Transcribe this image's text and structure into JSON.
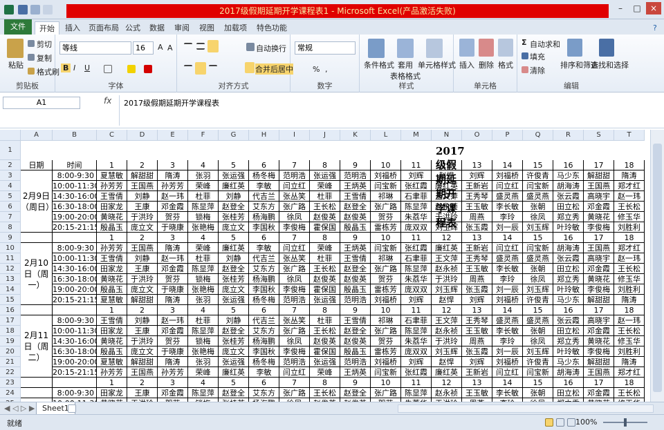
{
  "window": {
    "title": "2017级假期延期开学课程表1 - Microsoft Excel(产品激活失败)"
  },
  "ribbon": {
    "tabs": [
      "文件",
      "开始",
      "插入",
      "页面布局",
      "公式",
      "数据",
      "审阅",
      "视图",
      "加载项",
      "特色功能"
    ],
    "clipboard": {
      "paste": "粘贴",
      "cut": "剪切",
      "copy": "复制",
      "format_painter": "格式刷",
      "label": "剪贴板"
    },
    "font": {
      "name": "等线",
      "size": "16",
      "label": "字体"
    },
    "alignment": {
      "wrap": "自动换行",
      "merge": "合并后居中",
      "label": "对齐方式"
    },
    "number": {
      "format": "常规",
      "label": "数字"
    },
    "styles": {
      "cond": "条件格式",
      "table": "套用\n表格格式",
      "cell": "单元格样式",
      "label": "样式"
    },
    "cells": {
      "insert": "插入",
      "delete": "删除",
      "format": "格式",
      "label": "单元格"
    },
    "editing": {
      "autosum": "自动求和",
      "fill": "填充",
      "clear": "清除",
      "sort": "排序和筛选",
      "find": "查找和选择",
      "label": "编辑"
    }
  },
  "formula_bar": {
    "name_box": "A1",
    "fx": "fx",
    "content": "2017级假期延期开学课程表"
  },
  "columns": [
    "A",
    "B",
    "C",
    "D",
    "E",
    "F",
    "G",
    "H",
    "I",
    "J",
    "K",
    "L",
    "M",
    "N",
    "O",
    "P",
    "Q",
    "R",
    "S",
    "T"
  ],
  "rows": [
    "1",
    "2",
    "3",
    "4",
    "5",
    "6",
    "7",
    "8",
    "9",
    "10",
    "11",
    "12",
    "13",
    "14",
    "15",
    "16",
    "17",
    "18",
    "19",
    "20",
    "21",
    "22",
    "23",
    "24",
    "25"
  ],
  "sheet": {
    "title": "2017级假期延期开学课程表",
    "header": {
      "date": "日期",
      "time": "时间"
    },
    "nums": [
      "1",
      "2",
      "3",
      "4",
      "5",
      "6",
      "7",
      "8",
      "9",
      "10",
      "11",
      "12",
      "13",
      "14",
      "15",
      "16",
      "17",
      "18"
    ],
    "days": [
      "2月9日（周日）",
      "2月10日（周一）",
      "2月11日（周二）"
    ],
    "times_a": [
      "8:00-9:30",
      "10:00-11:30",
      "14:30-16:00",
      "16:30-18:00",
      "19:00-20:00",
      "20:15-21:15"
    ],
    "times_b": [
      "8:00-9:30",
      "10:00-11:30",
      "14:30-16:00",
      "16:30-18:00",
      "19:00-20:00",
      "20:15-21:15"
    ],
    "r3": [
      "夏慧敏",
      "解甜甜",
      "隋涛",
      "张羽",
      "张运强",
      "杨冬梅",
      "范明浩",
      "张运强",
      "范明浩",
      "刘福桥",
      "刘辉",
      "赵悍",
      "刘辉",
      "刘福桥",
      "许俊青",
      "马少东",
      "解甜甜",
      "隋涛"
    ],
    "r4": [
      "孙芳芳",
      "王国燕",
      "孙芳芳",
      "荣峰",
      "廉红英",
      "李敏",
      "闫立红",
      "荣峰",
      "王炳英",
      "闫宝新",
      "张红霞",
      "廉红英",
      "王新岩",
      "闫立红",
      "闫宝新",
      "胡海涛",
      "王国燕",
      "郑才红"
    ],
    "r5": [
      "王雪倩",
      "刘静",
      "赵一玮",
      "杜菲",
      "刘静",
      "代吉兰",
      "张丛笑",
      "杜菲",
      "王雪倩",
      "祁琳",
      "石聿菲",
      "王文萍",
      "王秀琴",
      "盛灵燕",
      "盛灵燕",
      "张云霞",
      "高晓宇",
      "赵一玮"
    ],
    "r6": [
      "田家龙",
      "王康",
      "邓金霞",
      "陈显萍",
      "赵登全",
      "艾东方",
      "张广路",
      "王长松",
      "赵登全",
      "张广路",
      "陈显萍",
      "赵永祯",
      "王玉敏",
      "李长敏",
      "张朝",
      "田立松",
      "邓金霞",
      "王长松"
    ],
    "r7": [
      "黄晓花",
      "于洪玲",
      "贺芬",
      "锁梅",
      "张桂芳",
      "杨海鹏",
      "徐凤",
      "赵俊英",
      "赵俊英",
      "贺芬",
      "朱荔华",
      "于洪玲",
      "周燕",
      "李玲",
      "徐凤",
      "郑立秀",
      "黄晓花",
      "修玉华"
    ],
    "r8": [
      "殷晶玉",
      "庞立文",
      "于晓康",
      "张艳梅",
      "庞立文",
      "李国秋",
      "李俊梅",
      "霍保国",
      "殷晶玉",
      "雷栋芳",
      "庞双双",
      "刘玉辉",
      "张玉霞",
      "刘一辰",
      "刘玉辉",
      "叶玲敏",
      "李俊梅",
      "刘胜利"
    ],
    "r9": [
      "孙芳芳",
      "王国燕",
      "隋涛",
      "荣峰",
      "廉红英",
      "李敏",
      "闫立红",
      "荣峰",
      "王炳英",
      "闫宝新",
      "张红霞",
      "廉红英",
      "王新岩",
      "闫立红",
      "闫宝新",
      "胡海涛",
      "王国燕",
      "郑才红"
    ],
    "r10": [
      "王雪倩",
      "刘静",
      "赵一玮",
      "杜菲",
      "刘静",
      "代吉兰",
      "张丛笑",
      "杜菲",
      "王雪倩",
      "祁琳",
      "石聿菲",
      "王文萍",
      "王秀琴",
      "盛灵燕",
      "盛灵燕",
      "张云霞",
      "高晓宇",
      "赵一玮"
    ],
    "r11": [
      "田家龙",
      "王康",
      "邓金霞",
      "陈显萍",
      "赵登全",
      "艾东方",
      "张广路",
      "王长松",
      "赵登全",
      "张广路",
      "陈显萍",
      "赵永祯",
      "王玉敏",
      "李长敏",
      "张朝",
      "田立松",
      "邓金霞",
      "王长松"
    ],
    "r12": [
      "黄晓花",
      "于洪玲",
      "贺芬",
      "锁梅",
      "张桂芳",
      "杨海鹏",
      "徐凤",
      "赵俊英",
      "赵俊英",
      "贺芬",
      "朱荔华",
      "于洪玲",
      "周燕",
      "李玲",
      "徐凤",
      "郑立秀",
      "黄晓花",
      "修玉华"
    ],
    "r13": [
      "殷晶玉",
      "庞立文",
      "于晓康",
      "张艳梅",
      "庞立文",
      "李国秋",
      "李俊梅",
      "霍保国",
      "殷晶玉",
      "雷栋芳",
      "庞双双",
      "刘玉辉",
      "张玉霞",
      "刘一辰",
      "刘玉辉",
      "叶玲敏",
      "李俊梅",
      "刘胜利"
    ],
    "r14": [
      "夏慧敏",
      "解甜甜",
      "隋涛",
      "张羽",
      "张运强",
      "杨冬梅",
      "范明浩",
      "张运强",
      "范明浩",
      "刘福桥",
      "刘辉",
      "赵悍",
      "刘辉",
      "刘福桥",
      "许俊青",
      "马少东",
      "解甜甜",
      "隋涛"
    ],
    "r15": [
      "王雪倩",
      "刘静",
      "赵一玮",
      "杜菲",
      "刘静",
      "代吉兰",
      "张丛笑",
      "杜菲",
      "王雪倩",
      "祁琳",
      "石聿菲",
      "王文萍",
      "王秀琴",
      "盛灵燕",
      "盛灵燕",
      "张云霞",
      "高晓宇",
      "赵一玮"
    ],
    "r16": [
      "田家龙",
      "王康",
      "邓金霞",
      "陈显萍",
      "赵登全",
      "艾东方",
      "张广路",
      "王长松",
      "赵登全",
      "张广路",
      "陈显萍",
      "赵永祯",
      "王玉敏",
      "李长敏",
      "张朝",
      "田立松",
      "邓金霞",
      "王长松"
    ],
    "r17": [
      "黄晓花",
      "于洪玲",
      "贺芬",
      "锁梅",
      "张桂芳",
      "杨海鹏",
      "徐凤",
      "赵俊英",
      "赵俊英",
      "贺芬",
      "朱荔华",
      "于洪玲",
      "周燕",
      "李玲",
      "徐凤",
      "郑立秀",
      "黄晓花",
      "修玉华"
    ],
    "r18": [
      "殷晶玉",
      "庞立文",
      "于晓康",
      "张艳梅",
      "庞立文",
      "李国秋",
      "李俊梅",
      "霍保国",
      "殷晶玉",
      "雷栋芳",
      "庞双双",
      "刘玉辉",
      "张玉霞",
      "刘一辰",
      "刘玉辉",
      "叶玲敏",
      "李俊梅",
      "刘胜利"
    ],
    "r19": [
      "夏慧敏",
      "解甜甜",
      "隋涛",
      "张羽",
      "张运强",
      "杨冬梅",
      "范明浩",
      "张运强",
      "范明浩",
      "刘福桥",
      "刘辉",
      "赵悍",
      "刘辉",
      "刘福桥",
      "许俊青",
      "马少东",
      "解甜甜",
      "隋涛"
    ],
    "r20": [
      "孙芳芳",
      "王国燕",
      "孙芳芳",
      "荣峰",
      "廉红英",
      "李敏",
      "闫立红",
      "荣峰",
      "王炳英",
      "闫宝新",
      "张红霞",
      "廉红英",
      "王新岩",
      "闫立红",
      "闫宝新",
      "胡海涛",
      "王国燕",
      "郑才红"
    ],
    "r22": [
      "田家龙",
      "王康",
      "邓金霞",
      "陈显萍",
      "赵登全",
      "艾东方",
      "张广路",
      "王长松",
      "赵登全",
      "张广路",
      "陈显萍",
      "赵永祯",
      "王玉敏",
      "李长敏",
      "张朝",
      "田立松",
      "邓金霞",
      "王长松"
    ],
    "r23": [
      "黄晓花",
      "于洪玲",
      "贺芬",
      "锁梅",
      "张桂芳",
      "杨海鹏",
      "徐凤",
      "赵俊英",
      "赵俊英",
      "贺芬",
      "朱荔华",
      "于洪玲",
      "周燕",
      "李玲",
      "徐凤",
      "郑立秀",
      "黄晓花",
      "修玉华"
    ]
  },
  "sheet_tab": "Sheet1",
  "status": {
    "ready": "就绪",
    "zoom": "100%"
  }
}
